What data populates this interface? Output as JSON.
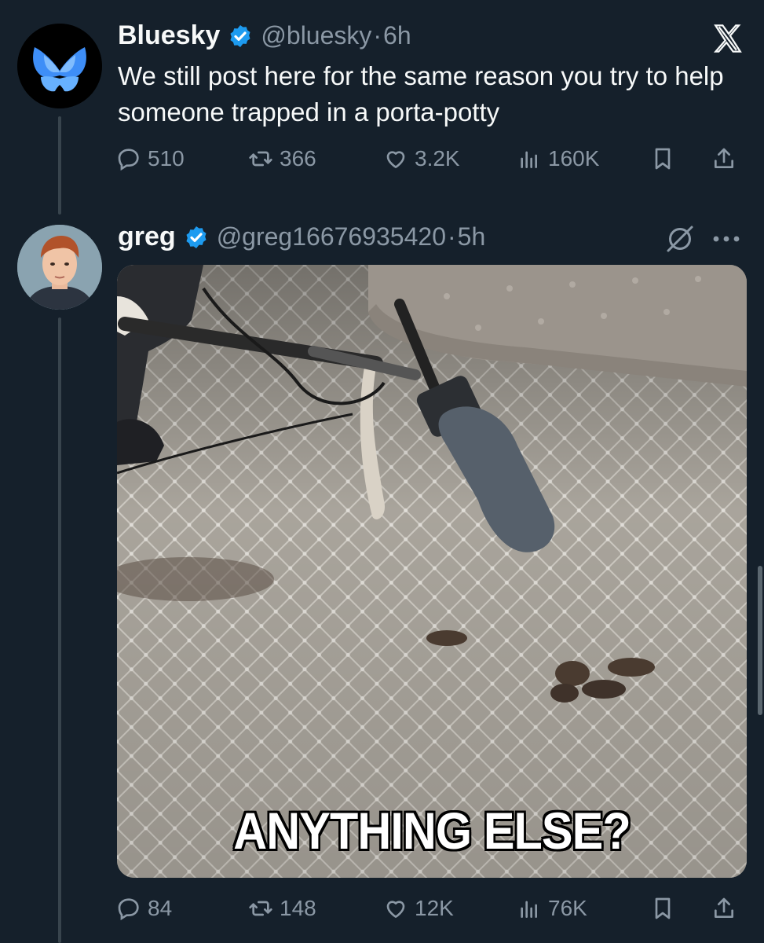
{
  "tweets": [
    {
      "name": "Bluesky",
      "handle": "@bluesky",
      "separator": "·",
      "time": "6h",
      "text": "We still post here for the same reason you try to help someone trapped in a porta-potty",
      "stats": {
        "replies": "510",
        "reposts": "366",
        "likes": "3.2K",
        "views": "160K"
      }
    },
    {
      "name": "greg",
      "handle": "@greg16676935420",
      "separator": "·",
      "time": "5h",
      "media_caption": "ANYTHING ELSE?",
      "stats": {
        "replies": "84",
        "reposts": "148",
        "likes": "12K",
        "views": "76K"
      }
    }
  ],
  "icons": {
    "verified": "verified-badge-icon",
    "close": "x-logo-icon",
    "grok": "grok-icon",
    "more": "more-options-icon",
    "reply": "reply-icon",
    "repost": "repost-icon",
    "like": "like-icon",
    "views": "views-icon",
    "bookmark": "bookmark-icon",
    "share": "share-icon"
  },
  "colors": {
    "background": "#15202b",
    "verified": "#1d9bf0",
    "secondary_text": "#8b98a5"
  }
}
